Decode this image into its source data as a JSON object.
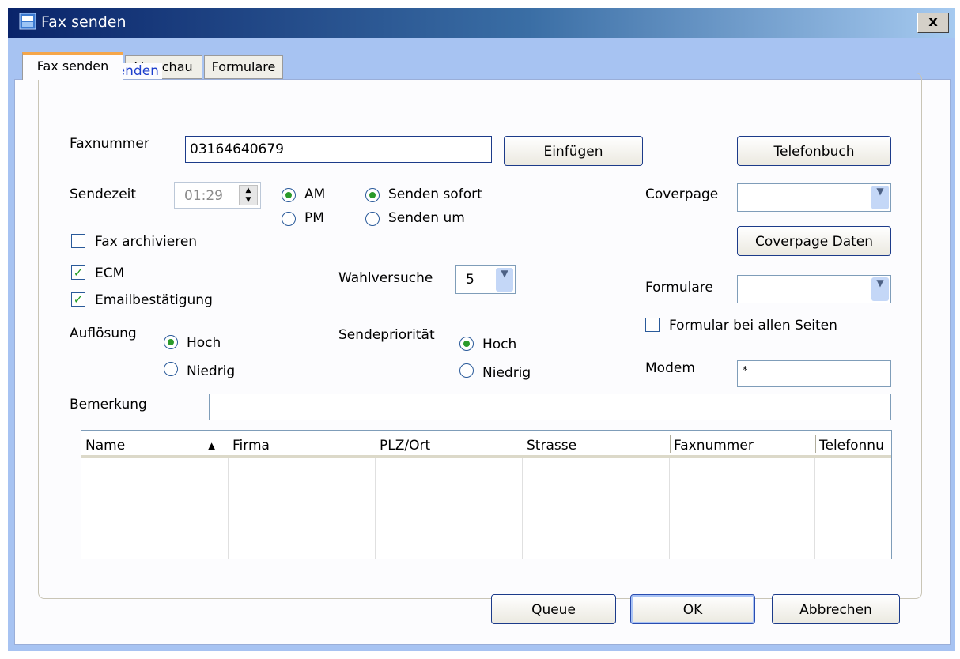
{
  "window": {
    "title": "Fax senden",
    "close_label": "x"
  },
  "tabs": [
    {
      "label": "Fax senden",
      "active": true
    },
    {
      "label": "Vorschau",
      "active": false
    },
    {
      "label": "Formulare",
      "active": false
    }
  ],
  "group_title": "Daten senden",
  "faxnummer": {
    "label": "Faxnummer",
    "value": "03164640679"
  },
  "buttons": {
    "einfuegen": "Einfügen",
    "telefonbuch": "Telefonbuch",
    "coverpage_daten": "Coverpage Daten",
    "queue": "Queue",
    "ok": "OK",
    "abbrechen": "Abbrechen"
  },
  "sendezeit": {
    "label": "Sendezeit",
    "value": "01:29"
  },
  "ampm": {
    "am": "AM",
    "pm": "PM",
    "selected": "AM"
  },
  "senden": {
    "sofort": "Senden sofort",
    "um": "Senden um",
    "selected": "sofort"
  },
  "coverpage": {
    "label": "Coverpage",
    "value": ""
  },
  "checkboxes": {
    "fax_archivieren": {
      "label": "Fax archivieren",
      "checked": false
    },
    "ecm": {
      "label": "ECM",
      "checked": true
    },
    "emailbestaetigung": {
      "label": "Emailbestätigung",
      "checked": true
    },
    "formular_alle": {
      "label": "Formular bei allen Seiten",
      "checked": false
    }
  },
  "wahlversuche": {
    "label": "Wahlversuche",
    "value": "5"
  },
  "formulare": {
    "label": "Formulare",
    "value": ""
  },
  "aufloesung": {
    "label": "Auflösung",
    "hoch": "Hoch",
    "niedrig": "Niedrig",
    "selected": "Hoch"
  },
  "sendeprioritaet": {
    "label": "Sendepriorität",
    "hoch": "Hoch",
    "niedrig": "Niedrig",
    "selected": "Hoch"
  },
  "modem": {
    "label": "Modem",
    "value": "*"
  },
  "bemerkung": {
    "label": "Bemerkung",
    "value": ""
  },
  "table": {
    "columns": [
      "Name",
      "Firma",
      "PLZ/Ort",
      "Strasse",
      "Faxnummer",
      "Telefonnu"
    ],
    "sort_column": "Name",
    "rows": []
  },
  "colors": {
    "title_start": "#0a246a",
    "title_end": "#a6caf0",
    "group_title": "#1e3fcc",
    "tab_accent": "#f5a64a",
    "check_mark": "#1d9a1d"
  }
}
